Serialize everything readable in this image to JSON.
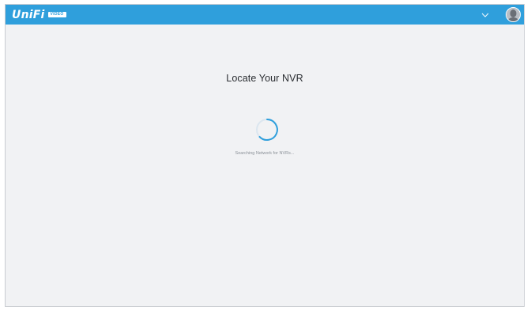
{
  "header": {
    "logo_text": "UniFi",
    "logo_badge": "VIDEO",
    "menu_icon": "chevron-down-icon",
    "avatar_icon": "user-avatar-icon"
  },
  "main": {
    "title": "Locate Your NVR",
    "status_text": "Searching Network for NVRs...",
    "spinner_icon": "loading-spinner-icon"
  },
  "colors": {
    "topbar": "#2f9fdc",
    "background": "#f1f2f4",
    "spinner": "#2f9fdc"
  }
}
